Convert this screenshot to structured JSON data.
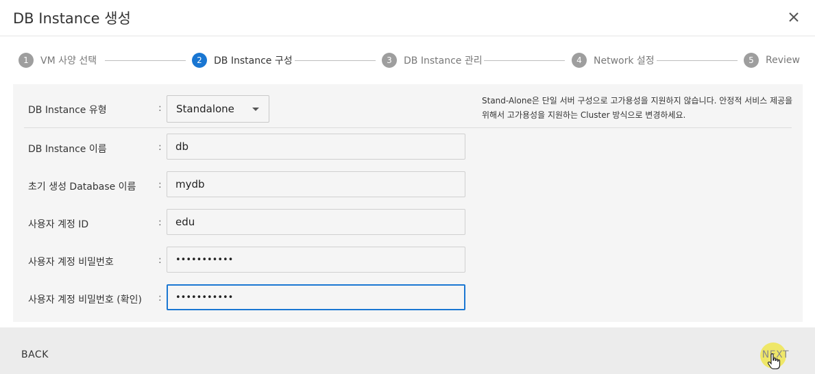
{
  "dialog": {
    "title": "DB Instance 생성",
    "close_icon": "close-icon"
  },
  "stepper": {
    "steps": [
      {
        "num": "1",
        "label": "VM 사양 선택",
        "active": false
      },
      {
        "num": "2",
        "label": "DB Instance 구성",
        "active": true
      },
      {
        "num": "3",
        "label": "DB Instance 관리",
        "active": false
      },
      {
        "num": "4",
        "label": "Network 설정",
        "active": false
      },
      {
        "num": "5",
        "label": "Review",
        "active": false
      }
    ]
  },
  "form": {
    "instance_type": {
      "label": "DB Instance 유형",
      "value": "Standalone"
    },
    "instance_name": {
      "label": "DB Instance 이름",
      "value": "db"
    },
    "initial_db": {
      "label": "초기 생성 Database 이름",
      "value": "mydb"
    },
    "user_id": {
      "label": "사용자 계정 ID",
      "value": "edu"
    },
    "password": {
      "label": "사용자 계정 비밀번호",
      "value": "•••••••••••"
    },
    "password_confirm": {
      "label": "사용자 계정 비밀번호 (확인)",
      "value": "•••••••••••"
    },
    "colon": ":",
    "info_text": "Stand-Alone은 단일 서버 구성으로 고가용성을 지원하지 않습니다. 안정적 서비스 제공을 위해서 고가용성을 지원하는 Cluster 방식으로 변경하세요."
  },
  "footer": {
    "back_label": "BACK",
    "next_label": "NEXT"
  },
  "colors": {
    "accent": "#1976d2",
    "step_inactive": "#9e9e9e",
    "cursor_highlight": "#f0e63c"
  }
}
